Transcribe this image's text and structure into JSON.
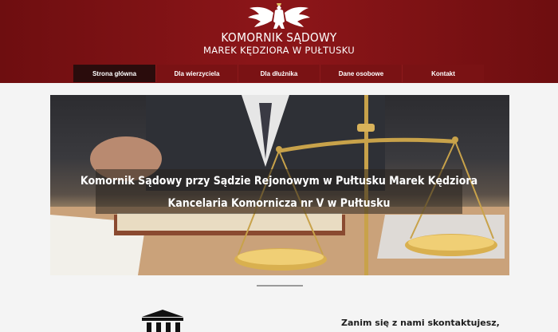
{
  "header": {
    "title_line1": "KOMORNIK SĄDOWY",
    "title_line2": "MAREK KĘDZIORA W PUŁTUSKU",
    "emblem_icon": "polish-eagle-icon"
  },
  "nav": {
    "items": [
      {
        "label": "Strona główna",
        "active": true
      },
      {
        "label": "Dla wierzyciela",
        "active": false
      },
      {
        "label": "Dla dłużnika",
        "active": false
      },
      {
        "label": "Dane osobowe",
        "active": false
      },
      {
        "label": "Kontakt",
        "active": false
      }
    ]
  },
  "hero": {
    "caption_line1": "Komornik Sądowy przy Sądzie Rejonowym w Pułtusku Marek Kędziora",
    "caption_line2": "Kancelaria Komornicza nr V w Pułtusku"
  },
  "section": {
    "icon": "courthouse-icon",
    "contact_text": "Zanim się z nami skontaktujesz,"
  },
  "colors": {
    "header_bg": "#8a1518",
    "nav_bg": "#7a1214",
    "nav_active_bg": "#2a0c0c"
  }
}
